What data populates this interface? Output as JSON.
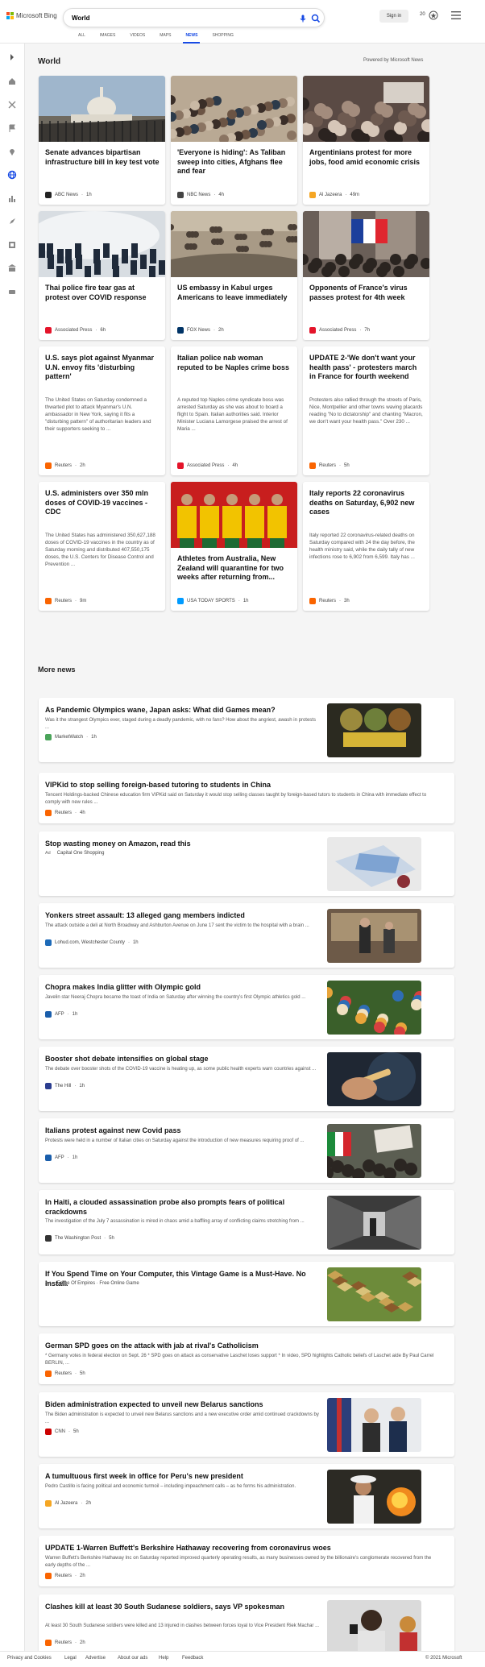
{
  "header": {
    "brand": "Microsoft Bing",
    "search_value": "World",
    "signin_label": "Sign in",
    "rewards_count": "20",
    "tabs": [
      "ALL",
      "IMAGES",
      "VIDEOS",
      "MAPS",
      "NEWS",
      "SHOPPING"
    ],
    "active_tab": "NEWS"
  },
  "section": {
    "title": "World",
    "powered_by": "Powered by Microsoft News"
  },
  "cards": [
    {
      "title": "Senate advances bipartisan infrastructure bill in key test vote",
      "source": "ABC News",
      "time": "1h",
      "image": "capitol-building"
    },
    {
      "title": "'Everyone is hiding': As Taliban sweep into cities, Afghans flee and fear",
      "source": "NBC News",
      "time": "4h",
      "image": "crowd"
    },
    {
      "title": "Argentinians protest for more jobs, food amid economic crisis",
      "source": "Al Jazeera",
      "time": "49m",
      "image": "protest"
    },
    {
      "title": "Thai police fire tear gas at protest over COVID response",
      "source": "Associated Press",
      "time": "6h",
      "image": "tear-gas"
    },
    {
      "title": "US embassy in Kabul urges Americans to leave immediately",
      "source": "FOX News",
      "time": "2h",
      "image": "kabul"
    },
    {
      "title": "Opponents of France's virus passes protest for 4th week",
      "source": "Associated Press",
      "time": "7h",
      "image": "france-flag"
    },
    {
      "title": "U.S. says plot against Myanmar U.N. envoy fits 'disturbing pattern'",
      "snippet": "The United States on Saturday condemned a thwarted plot to attack Myanmar's U.N. ambassador in New York, saying it fits a \"disturbing pattern\" of authoritarian leaders and their supporters seeking to ...",
      "source": "Reuters",
      "time": "2h"
    },
    {
      "title": "Italian police nab woman reputed to be Naples crime boss",
      "snippet": "A reputed top Naples crime syndicate boss was arrested Saturday as she was about to board a flight to Spain. Italian authorities said. Interior Minister Luciana Lamorgese praised the arrest of Maria ...",
      "source": "Associated Press",
      "time": "4h"
    },
    {
      "title": "UPDATE 2-'We don't want your health pass' - protesters march in France for fourth weekend",
      "snippet": "Protesters also rallied through the streets of Paris, Nice, Montpellier and other towns waving placards reading \"No to dictatorship\" and chanting \"Macron, we don't want your health pass.\" Over 230 ...",
      "source": "Reuters",
      "time": "5h"
    },
    {
      "title": "U.S. administers over 350 mln doses of COVID-19 vaccines - CDC",
      "snippet": "The United States has administered 350,627,188 doses of COVID-19 vaccines in the country as of Saturday morning and distributed 407,550,175 doses, the U.S. Centers for Disease Control and Prevention ...",
      "source": "Reuters",
      "time": "9m"
    },
    {
      "title": "Athletes from Australia, New Zealand will quarantine for two weeks after returning from...",
      "source": "USA TODAY SPORTS",
      "time": "1h",
      "image": "athletes"
    },
    {
      "title": "Italy reports 22 coronavirus deaths on Saturday, 6,902 new cases",
      "snippet": "Italy reported 22 coronavirus-related deaths on Saturday compared with 24 the day before, the health ministry said, while the daily tally of new infections rose to 6,902 from 6,599. Italy has ...",
      "source": "Reuters",
      "time": "3h"
    }
  ],
  "more_news": {
    "title": "More news",
    "items": [
      {
        "title": "As Pandemic Olympics wane, Japan asks: What did Games mean?",
        "snippet": "Was it the strangest Olympics ever, staged during a deadly pandemic, with no fans? How about the angriest, awash in protests ...",
        "source": "MarketWatch",
        "time": "1h",
        "image": "tokyo-2020"
      },
      {
        "title": "VIPKid to stop selling foreign-based tutoring to students in China",
        "snippet": "Tencent Holdings-backed Chinese education firm VIPKid said on Saturday it would stop selling classes taught by foreign-based tutors to students in China with immediate effect to comply with new rules ...",
        "source": "Reuters",
        "time": "4h"
      },
      {
        "title": "Stop wasting money on Amazon, read this",
        "ad": "Ad",
        "source": "Capital One Shopping",
        "image": "amazon-box"
      },
      {
        "title": "Yonkers street assault: 13 alleged gang members indicted",
        "snippet": "The attack outside a deli at North Broadway and Ashburton Avenue on June 17 sent the victim to the hospital with a brain ...",
        "source": "Lohud.com, Westchester County",
        "time": "1h",
        "image": "press-conference"
      },
      {
        "title": "Chopra makes India glitter with Olympic gold",
        "snippet": "Javelin star Neeraj Chopra became the toast of India on Saturday after winning the country's first Olympic athletics gold ...",
        "source": "AFP",
        "time": "1h",
        "image": "celebration"
      },
      {
        "title": "Booster shot debate intensifies on global stage",
        "snippet": "The debate over booster shots of the COVID-19 vaccine is heating up, as some public health experts warn countries against ...",
        "source": "The Hill",
        "time": "1h",
        "image": "vaccine"
      },
      {
        "title": "Italians protest against new Covid pass",
        "snippet": "Protests were held in a number of Italian cities on Saturday against the introduction of new measures requiring proof of ...",
        "source": "AFP",
        "time": "1h",
        "image": "italy-protest"
      },
      {
        "title": "In Haiti, a clouded assassination probe also prompts fears of political crackdowns",
        "snippet": "The investigation of the July 7 assassination is mired in chaos amid a baffling array of conflicting claims stretching from ...",
        "source": "The Washington Post",
        "time": "5h",
        "image": "hallway"
      },
      {
        "title": "If You Spend Time on Your Computer, this Vintage Game is a Must-Have. No Install.",
        "ad": "Ad",
        "source": "Forge Of Empires · Free Online Game",
        "image": "game"
      },
      {
        "title": "German SPD goes on the attack with jab at rival's Catholicism",
        "snippet": "* Germany votes in federal election on Sept. 26 * SPD goes on attack as conservative Laschet loses support * In video, SPD highlights Catholic beliefs of Laschet aide By Paul Carrel BERLIN, ...",
        "source": "Reuters",
        "time": "5h"
      },
      {
        "title": "Biden administration expected to unveil new Belarus sanctions",
        "snippet": "The Biden administration is expected to unveil new Belarus sanctions and a new executive order amid continued crackdowns by ...",
        "source": "CNN",
        "time": "5h",
        "image": "meeting"
      },
      {
        "title": "A tumultuous first week in office for Peru's new president",
        "snippet": "Pedro Castillo is facing political and economic turmoil – including impeachment calls – as he forms his administration.",
        "source": "Al Jazeera",
        "time": "2h",
        "image": "peru"
      },
      {
        "title": "UPDATE 1-Warren Buffett's Berkshire Hathaway recovering from coronavirus woes",
        "snippet": "Warren Buffett's Berkshire Hathaway Inc on Saturday reported improved quarterly operating results, as many businesses owned by the billionaire's conglomerate recovered from the early depths of the ...",
        "source": "Reuters",
        "time": "2h"
      },
      {
        "title": "Clashes kill at least 30 South Sudanese soldiers, says VP spokesman",
        "snippet": "At least 30 South Sudanese soldiers were killed and 13 injured in clashes between forces loyal to Vice President Riek Machar ...",
        "source": "Reuters",
        "time": "2h",
        "image": "speaker"
      }
    ]
  },
  "footer": {
    "links": [
      "Privacy and Cookies",
      "Legal",
      "Advertise",
      "About our ads",
      "Help",
      "Feedback"
    ],
    "copyright": "© 2021 Microsoft"
  },
  "colors": {
    "accent": "#174ae4",
    "reuters": "#fa6400",
    "ap": "#e4142a",
    "aljazeera": "#f5a623"
  }
}
